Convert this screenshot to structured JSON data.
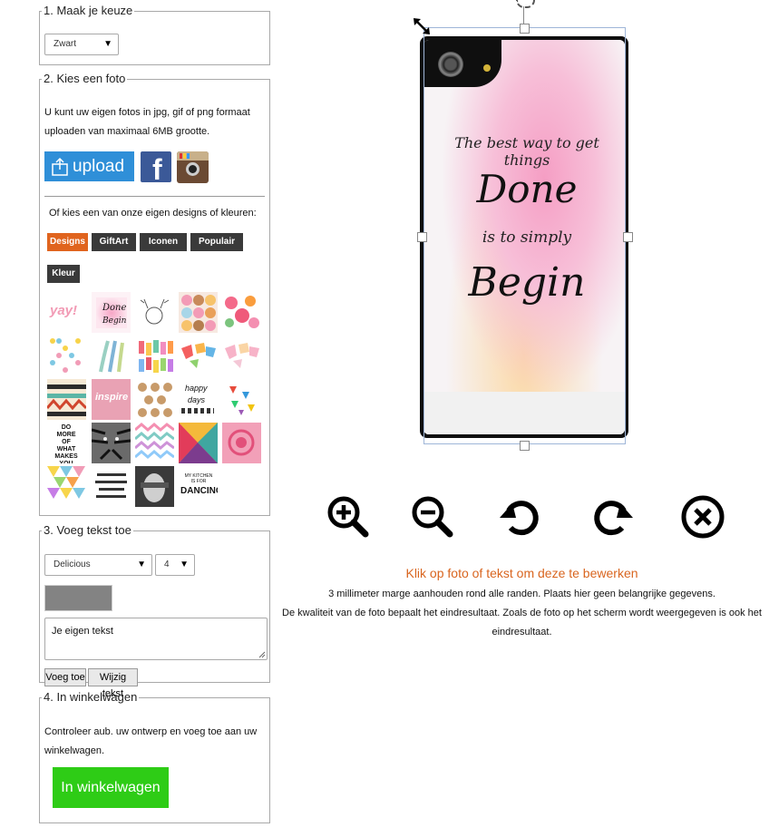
{
  "step1": {
    "legend": "1. Maak je keuze",
    "color_select": "Zwart"
  },
  "step2": {
    "legend": "2. Kies een foto",
    "intro_line1": "U kunt uw eigen fotos in jpg, gif of png formaat",
    "intro_line2": "uploaden van maximaal 6MB grootte.",
    "upload_label": "upload",
    "designs_intro": "Of kies een van onze eigen designs of kleuren:",
    "tabs": [
      "Designs",
      "GiftArt",
      "Iconen",
      "Populair",
      "Kleur"
    ],
    "thumb_texts": {
      "yay": "yay!",
      "done": "Done",
      "begin": "Begin",
      "happy": "happy",
      "days": "days",
      "quote1": "DO MORE OF WHAT MAKES YOU HAPPY",
      "kitchen": "MY KITCHEN IS FOR",
      "dancing": "DANCING",
      "pink_quote": "inspire"
    }
  },
  "step3": {
    "legend": "3. Voeg tekst toe",
    "font_select": "Delicious",
    "size_select": "4",
    "text_value": "Je eigen tekst",
    "add_button": "Voeg toe",
    "edit_button": "Wijzig tekst"
  },
  "step4": {
    "legend": "4. In winkelwagen",
    "text_line1": "Controleer aub. uw ontwerp en voeg toe aan uw",
    "text_line2": "winkelwagen.",
    "cart_button": "In winkelwagen"
  },
  "phone": {
    "quote_line1": "The best way to get things",
    "quote_done": "Done",
    "quote_line3": "is to simply",
    "quote_begin": "Begin"
  },
  "toolbar_icons": [
    "zoom-in-icon",
    "zoom-out-icon",
    "rotate-left-icon",
    "rotate-right-icon",
    "delete-icon"
  ],
  "info": {
    "headline": "Klik op foto of tekst om deze te bewerken",
    "line1": "3 millimeter marge aanhouden rond alle randen. Plaats hier geen belangrijke gegevens.",
    "line2": "De kwaliteit van de foto bepaalt het eindresultaat. Zoals de foto op het scherm wordt weergegeven is ook het",
    "line3": "eindresultaat."
  },
  "colors": {
    "accent_orange": "#e0641e",
    "tab_active": "#e0641e",
    "tab_dark": "#3a3a3a",
    "upload_blue": "#2f8fd8",
    "cart_green": "#2ecc16",
    "headline_orange": "#d9651f"
  }
}
